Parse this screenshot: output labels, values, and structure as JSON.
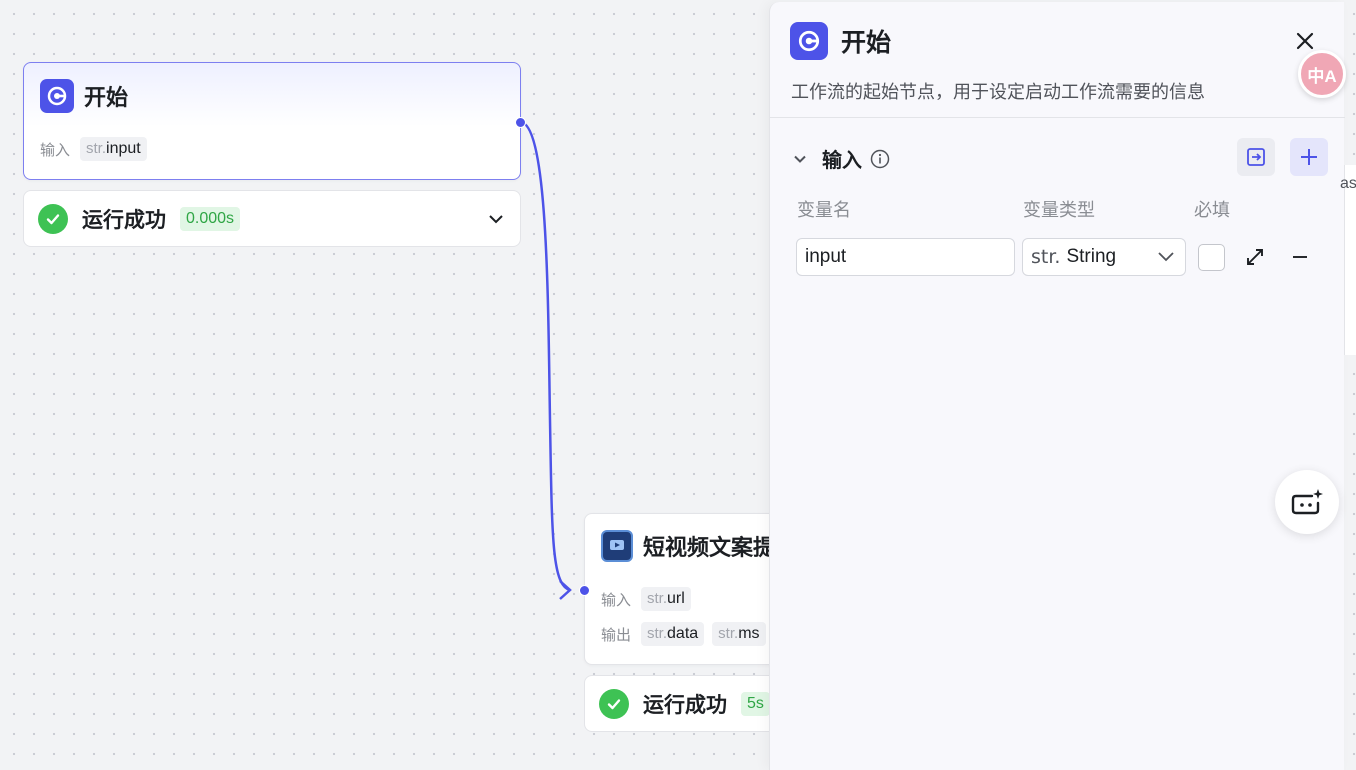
{
  "start_node": {
    "title": "开始",
    "input_label": "输入",
    "input_type": "str.",
    "input_name": "input",
    "status": "运行成功",
    "time": "0.000s"
  },
  "video_node": {
    "title": "短视频文案提",
    "input_label": "输入",
    "output_label": "输出",
    "input_type": "str.",
    "input_name": "url",
    "output_type_1": "str.",
    "output_name_1": "data",
    "output_type_2": "str.",
    "output_name_2": "ms",
    "status": "运行成功",
    "time": "5s"
  },
  "panel": {
    "title": "开始",
    "description": "工作流的起始节点，用于设定启动工作流需要的信息",
    "section_title": "输入",
    "columns": {
      "name": "变量名",
      "type": "变量类型",
      "required": "必填"
    },
    "variable": {
      "name": "input",
      "type_prefix": "str.",
      "type": "String",
      "required": false
    }
  },
  "floating": {
    "translate_label": "中A",
    "edge_text": "as"
  },
  "colors": {
    "accent": "#4d53e8",
    "success": "#3ec254",
    "success_bg": "#e1f6e5"
  }
}
